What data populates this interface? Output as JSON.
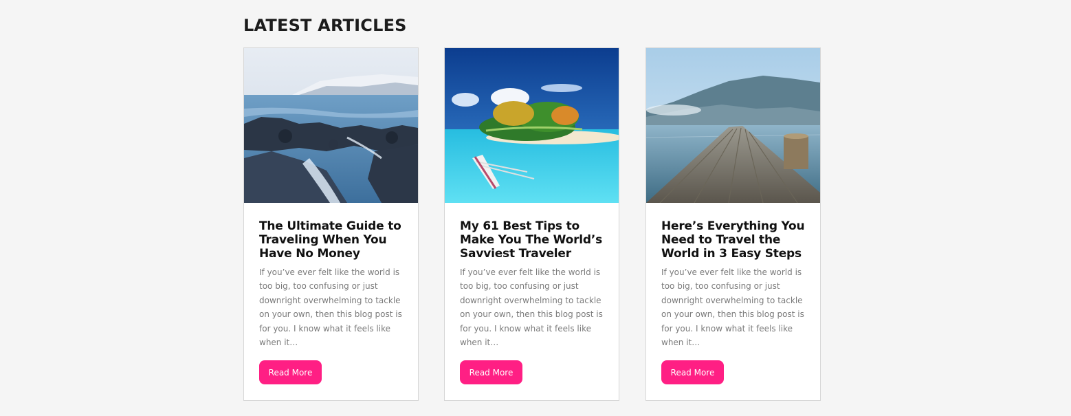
{
  "section": {
    "title": "LATEST ARTICLES"
  },
  "theme": {
    "accent": "#ff1f84",
    "background": "#f5f5f5",
    "card_border": "#d6d6d6"
  },
  "articles": [
    {
      "image": "rocky-coast-photo",
      "title": "The Ultimate Guide to Traveling When You Have No Money",
      "excerpt": "If you’ve ever felt like the world is too big, too confusing or just downright overwhelming to tackle on your own, then this blog post is for you. I know what it feels like when it…",
      "button": "Read More"
    },
    {
      "image": "tropical-island-photo",
      "title": "My 61 Best Tips to Make You The World’s Savviest Traveler",
      "excerpt": "If you’ve ever felt like the world is too big, too confusing or just downright overwhelming to tackle on your own, then this blog post is for you. I know what it feels like when it…",
      "button": "Read More"
    },
    {
      "image": "lake-pier-photo",
      "title": "Here’s Everything You Need to Travel the World in 3 Easy Steps",
      "excerpt": "If you’ve ever felt like the world is too big, too confusing or just downright overwhelming to tackle on your own, then this blog post is for you. I know what it feels like when it…",
      "button": "Read More"
    }
  ]
}
